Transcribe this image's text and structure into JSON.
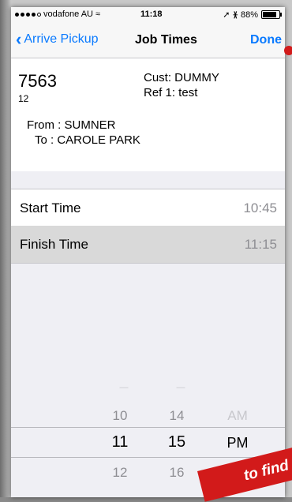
{
  "status": {
    "carrier": "vodafone AU",
    "time": "11:18",
    "battery": "88%"
  },
  "nav": {
    "back_label": "Arrive Pickup",
    "title": "Job Times",
    "done_label": "Done"
  },
  "job": {
    "number": "7563",
    "sub": "12",
    "cust": "Cust: DUMMY",
    "ref": "Ref 1: test",
    "from": "From : SUMNER",
    "to": "To : CAROLE PARK"
  },
  "times": {
    "start_label": "Start Time",
    "start_value": "10:45",
    "finish_label": "Finish Time",
    "finish_value": "11:15"
  },
  "picker": {
    "hours": [
      "10",
      "11",
      "12"
    ],
    "minutes": [
      "14",
      "15",
      "16"
    ],
    "ampm": [
      "AM",
      "PM"
    ]
  },
  "banner": {
    "text": "to find t"
  },
  "colors": {
    "accent": "#0a7aff",
    "highlight_row": "#d9d9d9",
    "annotation": "#d21a1a"
  }
}
